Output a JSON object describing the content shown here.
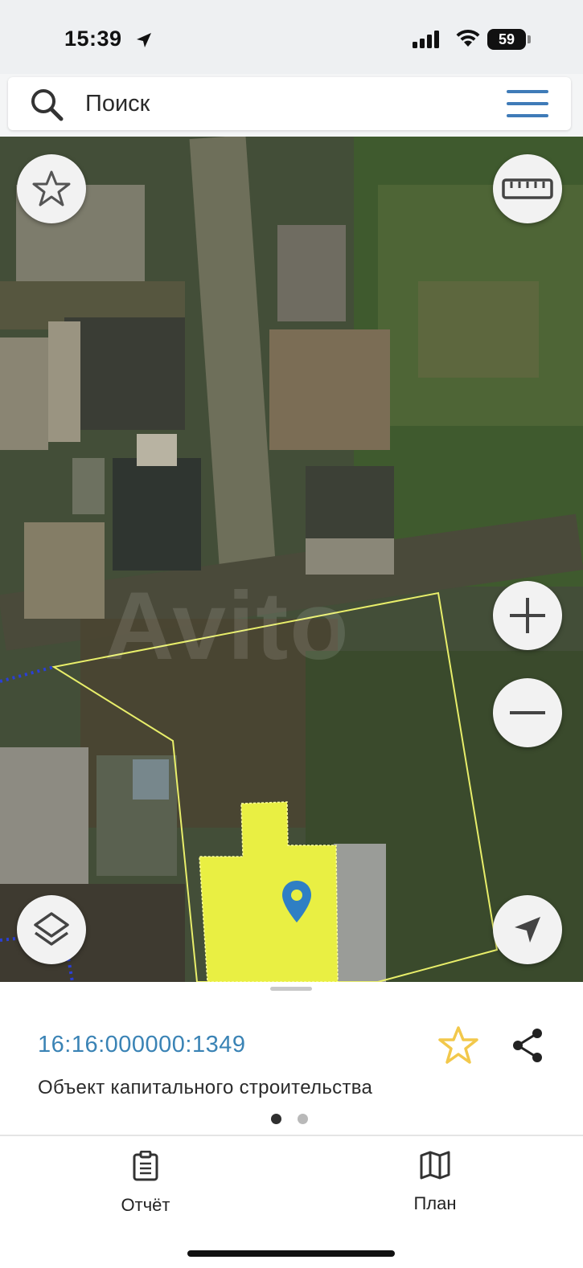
{
  "status_bar": {
    "time": "15:39",
    "battery": "59",
    "icons": [
      "location-arrow-icon",
      "signal-icon",
      "wifi-icon",
      "battery-icon"
    ]
  },
  "search": {
    "placeholder": "Поиск",
    "value": "",
    "icon": "search-icon",
    "menu_icon": "menu-icon"
  },
  "map": {
    "watermark": "Avito",
    "buttons": {
      "favorite": "star-icon",
      "ruler": "ruler-icon",
      "zoom_in": "plus-icon",
      "zoom_out": "minus-icon",
      "layers": "layers-icon",
      "locate": "navigation-arrow-icon"
    },
    "colors": {
      "parcel_outline": "#e8ee6a",
      "building_fill": "#e9ef43",
      "marker": "#2f7fc4",
      "boundary_dots": "#2a3fd6"
    }
  },
  "object": {
    "cadastral_number": "16:16:000000:1349",
    "type": "Объект капитального строительства",
    "pages": 2,
    "active_page": 1,
    "accent_color": "#3a83b5",
    "star_color": "#f2c84b"
  },
  "tabs": [
    {
      "label": "Отчёт",
      "icon": "report-clipboard-icon"
    },
    {
      "label": "План",
      "icon": "map-plan-icon"
    }
  ]
}
